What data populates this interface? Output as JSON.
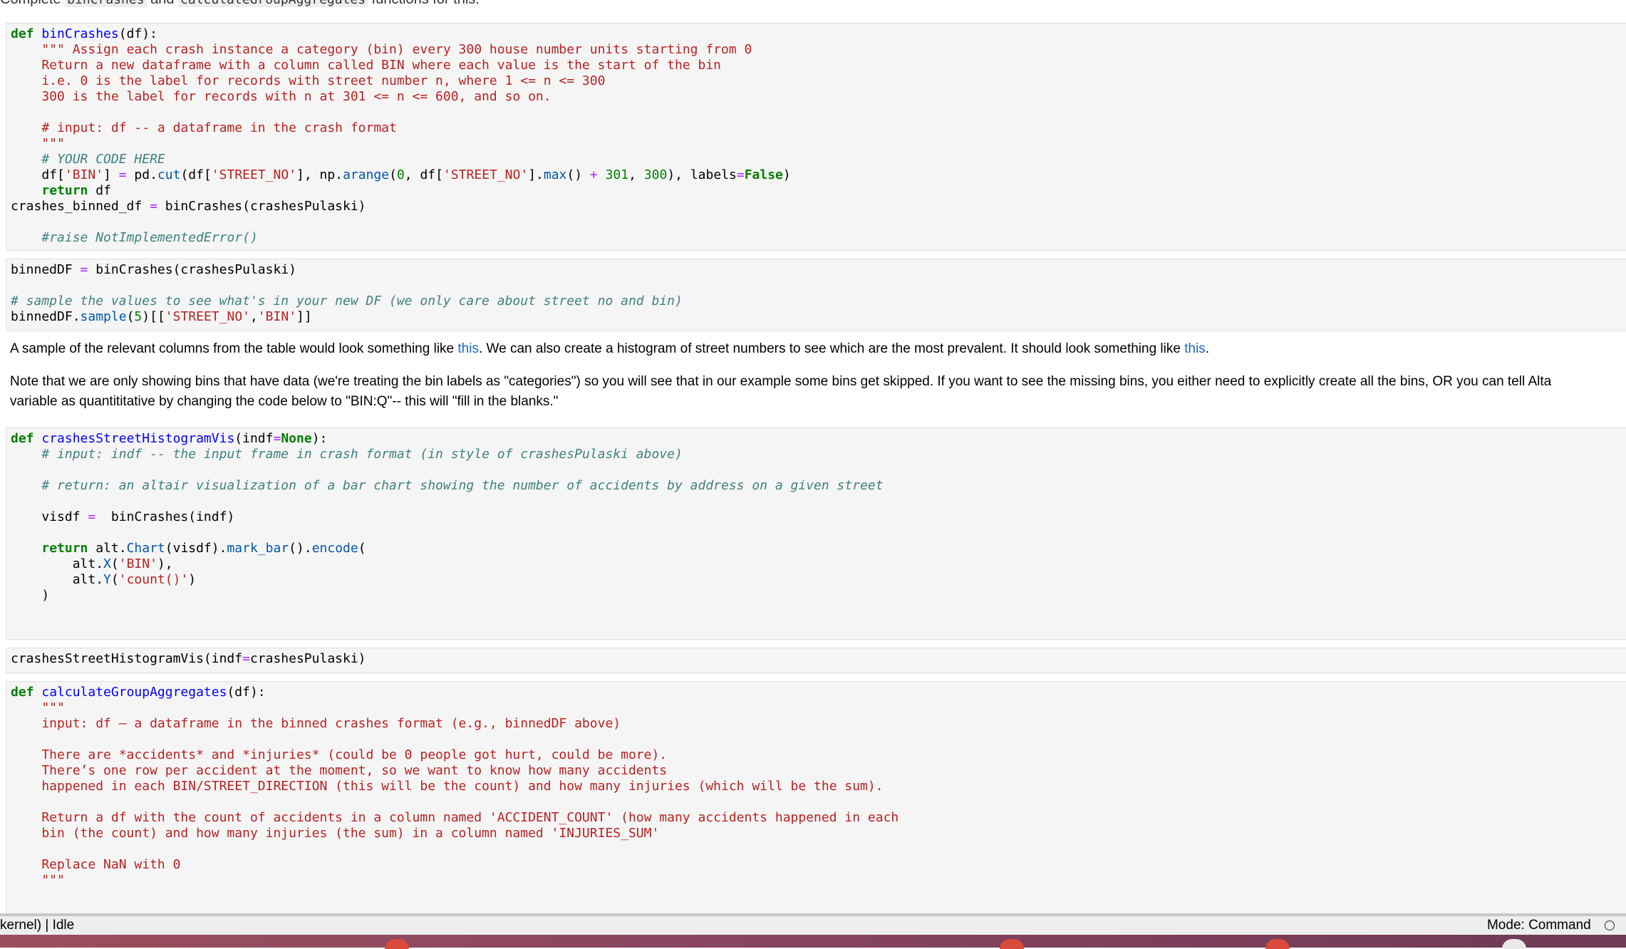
{
  "top_text": {
    "prefix": "Complete ",
    "code1": "binCrashes",
    "mid": " and ",
    "code2": "calculateGroupAggregates",
    "suffix": " functions for this."
  },
  "md1": {
    "before1": "A sample of the relevant columns from the table would look something like ",
    "link1": "this",
    "after1": ". We can also create a histogram of street numbers to see which are the most prevalent. It should look something like ",
    "link2": "this",
    "after2": "."
  },
  "md2": {
    "line1": "Note that we are only showing bins that have data (we're treating the bin labels as \"categories\") so you will see that in our example some bins get skipped. If you want to see the missing bins, you either need to explicitly create all the bins, OR you can tell Alta",
    "line2": "variable as quantititative by changing the code below to \"BIN:Q\"-- this will \"fill in the blanks.\""
  },
  "status": {
    "left": "kernel) | Idle",
    "right": "Mode: Command"
  }
}
